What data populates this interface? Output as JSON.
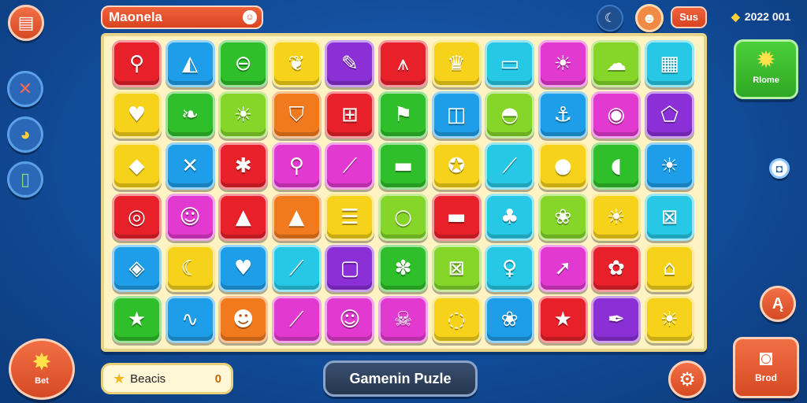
{
  "header": {
    "title": "Maonela",
    "title_badge_icon": "smile-icon",
    "score_label": "Sus",
    "date_label": "2022 001"
  },
  "left_rail": [
    {
      "name": "menu-button",
      "icon": "board-icon"
    },
    {
      "name": "tools-button",
      "icon": "wrench-icon"
    },
    {
      "name": "fish-button",
      "icon": "fish-icon"
    },
    {
      "name": "book-button",
      "icon": "book-icon"
    }
  ],
  "right_panel": {
    "home_label": "Rlome",
    "bread_label": "Brod"
  },
  "footer": {
    "bet_label": "Bet",
    "beach_label": "Beacis",
    "beach_value": "0",
    "puzzle_label": "Gamenin Puzle"
  },
  "colors": {
    "red": "#e8202a",
    "blue": "#1e9ee8",
    "green": "#2fbf2a",
    "yellow": "#f6d21a",
    "purple": "#8b2fd6",
    "cyan": "#27c8e6",
    "orange": "#f27a1e",
    "pink": "#e23ad0",
    "lime": "#86d62a"
  },
  "board": {
    "rows": [
      [
        [
          "red",
          "magnifier-icon"
        ],
        [
          "blue",
          "sail-icon"
        ],
        [
          "green",
          "coin-icon"
        ],
        [
          "yellow",
          "leaf-icon"
        ],
        [
          "purple",
          "pencil-icon"
        ],
        [
          "red",
          "easel-icon"
        ],
        [
          "yellow",
          "crown-icon"
        ],
        [
          "cyan",
          "flag-icon"
        ],
        [
          "pink",
          "sun-icon"
        ],
        [
          "lime",
          "cloud-icon"
        ],
        [
          "cyan",
          "map-icon"
        ]
      ],
      [
        [
          "yellow",
          "heart-icon"
        ],
        [
          "green",
          "vine-icon"
        ],
        [
          "lime",
          "sun-icon"
        ],
        [
          "orange",
          "shield-icon"
        ],
        [
          "red",
          "grid-icon"
        ],
        [
          "green",
          "bird-icon"
        ],
        [
          "blue",
          "door-icon"
        ],
        [
          "lime",
          "cupcake-icon"
        ],
        [
          "blue",
          "anchor-icon"
        ],
        [
          "pink",
          "badge-icon"
        ],
        [
          "purple",
          "ticket-icon"
        ]
      ],
      [
        [
          "yellow",
          "drop-icon"
        ],
        [
          "blue",
          "cross-icon"
        ],
        [
          "red",
          "splat-icon"
        ],
        [
          "pink",
          "magnifier-icon"
        ],
        [
          "pink",
          "feather-icon"
        ],
        [
          "green",
          "chat-icon"
        ],
        [
          "yellow",
          "star-face-icon"
        ],
        [
          "cyan",
          "brush-icon"
        ],
        [
          "yellow",
          "blob-icon"
        ],
        [
          "green",
          "fish-icon"
        ],
        [
          "blue",
          "sun-icon"
        ]
      ],
      [
        [
          "red",
          "eye-icon"
        ],
        [
          "pink",
          "face-icon"
        ],
        [
          "red",
          "cream-icon"
        ],
        [
          "orange",
          "cream-icon"
        ],
        [
          "yellow",
          "stack-icon"
        ],
        [
          "lime",
          "ring-icon"
        ],
        [
          "red",
          "card-icon"
        ],
        [
          "cyan",
          "tree-icon"
        ],
        [
          "lime",
          "cat-icon"
        ],
        [
          "yellow",
          "sun-icon"
        ],
        [
          "cyan",
          "net-icon"
        ]
      ],
      [
        [
          "blue",
          "diamond-icon"
        ],
        [
          "yellow",
          "moon-icon"
        ],
        [
          "blue",
          "heart-icon"
        ],
        [
          "cyan",
          "crayon-icon"
        ],
        [
          "purple",
          "tv-icon"
        ],
        [
          "green",
          "palm-icon"
        ],
        [
          "lime",
          "net-icon"
        ],
        [
          "cyan",
          "lollipop-icon"
        ],
        [
          "pink",
          "cursor-icon"
        ],
        [
          "red",
          "bubble-icon"
        ],
        [
          "yellow",
          "house-icon"
        ]
      ],
      [
        [
          "green",
          "star-icon"
        ],
        [
          "blue",
          "wave-icon"
        ],
        [
          "orange",
          "drop-face-icon"
        ],
        [
          "pink",
          "crayon-icon"
        ],
        [
          "pink",
          "mask-icon"
        ],
        [
          "pink",
          "skull-icon"
        ],
        [
          "yellow",
          "speech-icon"
        ],
        [
          "blue",
          "cat-icon"
        ],
        [
          "red",
          "star-icon"
        ],
        [
          "purple",
          "quill-icon"
        ],
        [
          "yellow",
          "sun-icon"
        ]
      ]
    ]
  }
}
